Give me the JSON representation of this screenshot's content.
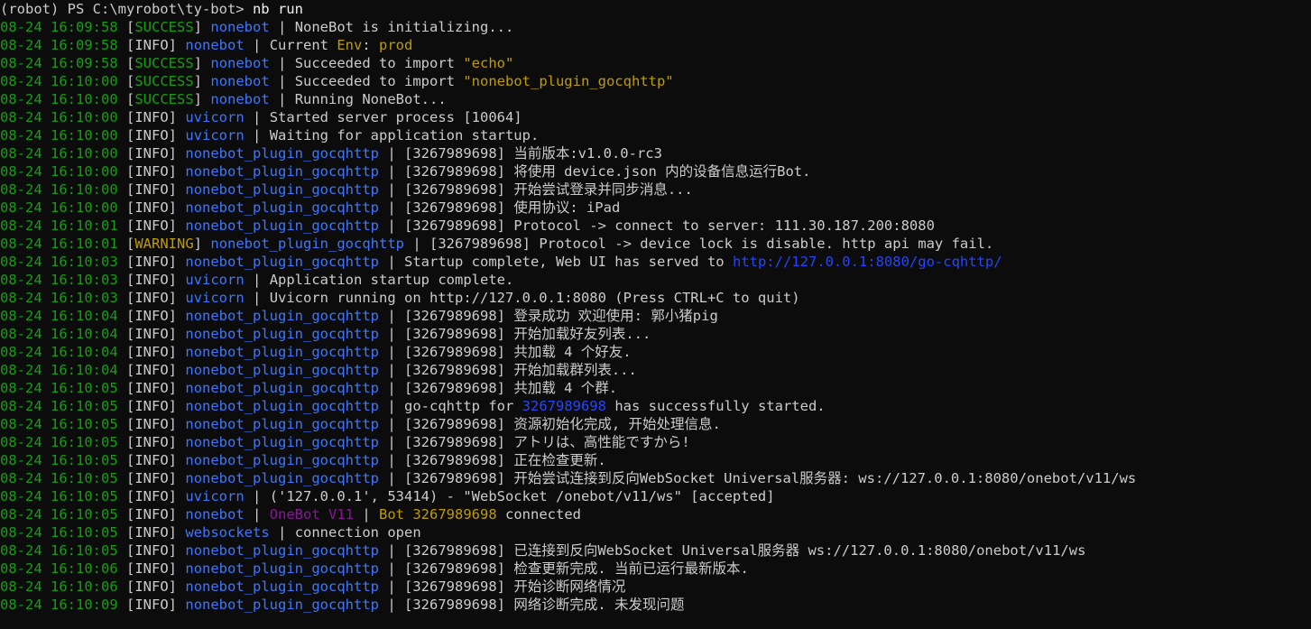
{
  "prompt": {
    "text": "(robot) PS C:\\myrobot\\ty-bot>",
    "command": "nb run"
  },
  "lines": [
    {
      "ts": "08-24 16:09:58",
      "level": "SUCCESS",
      "source": "nonebot",
      "parts": [
        {
          "t": "NoneBot is initializing..."
        }
      ]
    },
    {
      "ts": "08-24 16:09:58",
      "level": "INFO",
      "source": "nonebot",
      "parts": [
        {
          "t": "Current "
        },
        {
          "t": "Env",
          "c": "hl-yellow"
        },
        {
          "t": ": "
        },
        {
          "t": "prod",
          "c": "hl-yellow"
        }
      ]
    },
    {
      "ts": "08-24 16:09:58",
      "level": "SUCCESS",
      "source": "nonebot",
      "parts": [
        {
          "t": "Succeeded to import "
        },
        {
          "t": "\"echo\"",
          "c": "hl-yellow"
        }
      ]
    },
    {
      "ts": "08-24 16:10:00",
      "level": "SUCCESS",
      "source": "nonebot",
      "parts": [
        {
          "t": "Succeeded to import "
        },
        {
          "t": "\"nonebot_plugin_gocqhttp\"",
          "c": "hl-yellow"
        }
      ]
    },
    {
      "ts": "08-24 16:10:00",
      "level": "SUCCESS",
      "source": "nonebot",
      "parts": [
        {
          "t": "Running NoneBot..."
        }
      ]
    },
    {
      "ts": "08-24 16:10:00",
      "level": "INFO",
      "source": "uvicorn",
      "parts": [
        {
          "t": "Started server process [10064]"
        }
      ]
    },
    {
      "ts": "08-24 16:10:00",
      "level": "INFO",
      "source": "uvicorn",
      "parts": [
        {
          "t": "Waiting for application startup."
        }
      ]
    },
    {
      "ts": "08-24 16:10:00",
      "level": "INFO",
      "source": "nonebot_plugin_gocqhttp",
      "parts": [
        {
          "t": "[3267989698] 当前版本:v1.0.0-rc3"
        }
      ]
    },
    {
      "ts": "08-24 16:10:00",
      "level": "INFO",
      "source": "nonebot_plugin_gocqhttp",
      "parts": [
        {
          "t": "[3267989698] 将使用 device.json 内的设备信息运行Bot."
        }
      ]
    },
    {
      "ts": "08-24 16:10:00",
      "level": "INFO",
      "source": "nonebot_plugin_gocqhttp",
      "parts": [
        {
          "t": "[3267989698] 开始尝试登录并同步消息..."
        }
      ]
    },
    {
      "ts": "08-24 16:10:00",
      "level": "INFO",
      "source": "nonebot_plugin_gocqhttp",
      "parts": [
        {
          "t": "[3267989698] 使用协议: iPad"
        }
      ]
    },
    {
      "ts": "08-24 16:10:01",
      "level": "INFO",
      "source": "nonebot_plugin_gocqhttp",
      "parts": [
        {
          "t": "[3267989698] Protocol -> connect to server: 111.30.187.200:8080"
        }
      ]
    },
    {
      "ts": "08-24 16:10:01",
      "level": "WARNING",
      "source": "nonebot_plugin_gocqhttp",
      "parts": [
        {
          "t": "[3267989698] Protocol -> device lock is disable. http api may fail."
        }
      ]
    },
    {
      "ts": "08-24 16:10:03",
      "level": "INFO",
      "source": "nonebot_plugin_gocqhttp",
      "parts": [
        {
          "t": "Startup complete, Web UI has served to "
        },
        {
          "t": "http://127.0.0.1:8080/go-cqhttp/",
          "c": "underline-link"
        }
      ]
    },
    {
      "ts": "08-24 16:10:03",
      "level": "INFO",
      "source": "uvicorn",
      "parts": [
        {
          "t": "Application startup complete."
        }
      ]
    },
    {
      "ts": "08-24 16:10:03",
      "level": "INFO",
      "source": "uvicorn",
      "parts": [
        {
          "t": "Uvicorn running on http://127.0.0.1:8080 (Press CTRL+C to quit)"
        }
      ]
    },
    {
      "ts": "08-24 16:10:04",
      "level": "INFO",
      "source": "nonebot_plugin_gocqhttp",
      "parts": [
        {
          "t": "[3267989698] 登录成功 欢迎使用: 郭小猪pig"
        }
      ]
    },
    {
      "ts": "08-24 16:10:04",
      "level": "INFO",
      "source": "nonebot_plugin_gocqhttp",
      "parts": [
        {
          "t": "[3267989698] 开始加载好友列表..."
        }
      ]
    },
    {
      "ts": "08-24 16:10:04",
      "level": "INFO",
      "source": "nonebot_plugin_gocqhttp",
      "parts": [
        {
          "t": "[3267989698] 共加载 4 个好友."
        }
      ]
    },
    {
      "ts": "08-24 16:10:04",
      "level": "INFO",
      "source": "nonebot_plugin_gocqhttp",
      "parts": [
        {
          "t": "[3267989698] 开始加载群列表..."
        }
      ]
    },
    {
      "ts": "08-24 16:10:05",
      "level": "INFO",
      "source": "nonebot_plugin_gocqhttp",
      "parts": [
        {
          "t": "[3267989698] 共加载 4 个群."
        }
      ]
    },
    {
      "ts": "08-24 16:10:05",
      "level": "INFO",
      "source": "nonebot_plugin_gocqhttp",
      "parts": [
        {
          "t": "go-cqhttp for "
        },
        {
          "t": "3267989698",
          "c": "hl-blue"
        },
        {
          "t": " has successfully started."
        }
      ]
    },
    {
      "ts": "08-24 16:10:05",
      "level": "INFO",
      "source": "nonebot_plugin_gocqhttp",
      "parts": [
        {
          "t": "[3267989698] 资源初始化完成, 开始处理信息."
        }
      ]
    },
    {
      "ts": "08-24 16:10:05",
      "level": "INFO",
      "source": "nonebot_plugin_gocqhttp",
      "parts": [
        {
          "t": "[3267989698] アトリは、高性能ですから!"
        }
      ]
    },
    {
      "ts": "08-24 16:10:05",
      "level": "INFO",
      "source": "nonebot_plugin_gocqhttp",
      "parts": [
        {
          "t": "[3267989698] 正在检查更新."
        }
      ]
    },
    {
      "ts": "08-24 16:10:05",
      "level": "INFO",
      "source": "nonebot_plugin_gocqhttp",
      "parts": [
        {
          "t": "[3267989698] 开始尝试连接到反向WebSocket Universal服务器: ws://127.0.0.1:8080/onebot/v11/ws"
        }
      ]
    },
    {
      "ts": "08-24 16:10:05",
      "level": "INFO",
      "source": "uvicorn",
      "parts": [
        {
          "t": "('127.0.0.1', 53414) - \"WebSocket /onebot/v11/ws\" [accepted]"
        }
      ]
    },
    {
      "ts": "08-24 16:10:05",
      "level": "INFO",
      "source": "nonebot",
      "parts": [
        {
          "t": "OneBot V11",
          "c": "hl-purple"
        },
        {
          "t": " | ",
          "c": "sep"
        },
        {
          "t": "Bot 3267989698",
          "c": "hl-yellow"
        },
        {
          "t": " connected"
        }
      ]
    },
    {
      "ts": "08-24 16:10:05",
      "level": "INFO",
      "source": "websockets",
      "parts": [
        {
          "t": "connection open"
        }
      ]
    },
    {
      "ts": "08-24 16:10:05",
      "level": "INFO",
      "source": "nonebot_plugin_gocqhttp",
      "parts": [
        {
          "t": "[3267989698] 已连接到反向WebSocket Universal服务器 ws://127.0.0.1:8080/onebot/v11/ws"
        }
      ]
    },
    {
      "ts": "08-24 16:10:06",
      "level": "INFO",
      "source": "nonebot_plugin_gocqhttp",
      "parts": [
        {
          "t": "[3267989698] 检查更新完成. 当前已运行最新版本."
        }
      ]
    },
    {
      "ts": "08-24 16:10:06",
      "level": "INFO",
      "source": "nonebot_plugin_gocqhttp",
      "parts": [
        {
          "t": "[3267989698] 开始诊断网络情况"
        }
      ]
    },
    {
      "ts": "08-24 16:10:09",
      "level": "INFO",
      "source": "nonebot_plugin_gocqhttp",
      "parts": [
        {
          "t": "[3267989698] 网络诊断完成. 未发现问题"
        }
      ]
    }
  ],
  "colors": {
    "background": "#0c0c0c",
    "text": "#cccccc",
    "timestamp": "#13a10e",
    "source": "#3b78ff",
    "warning": "#c19c00"
  }
}
